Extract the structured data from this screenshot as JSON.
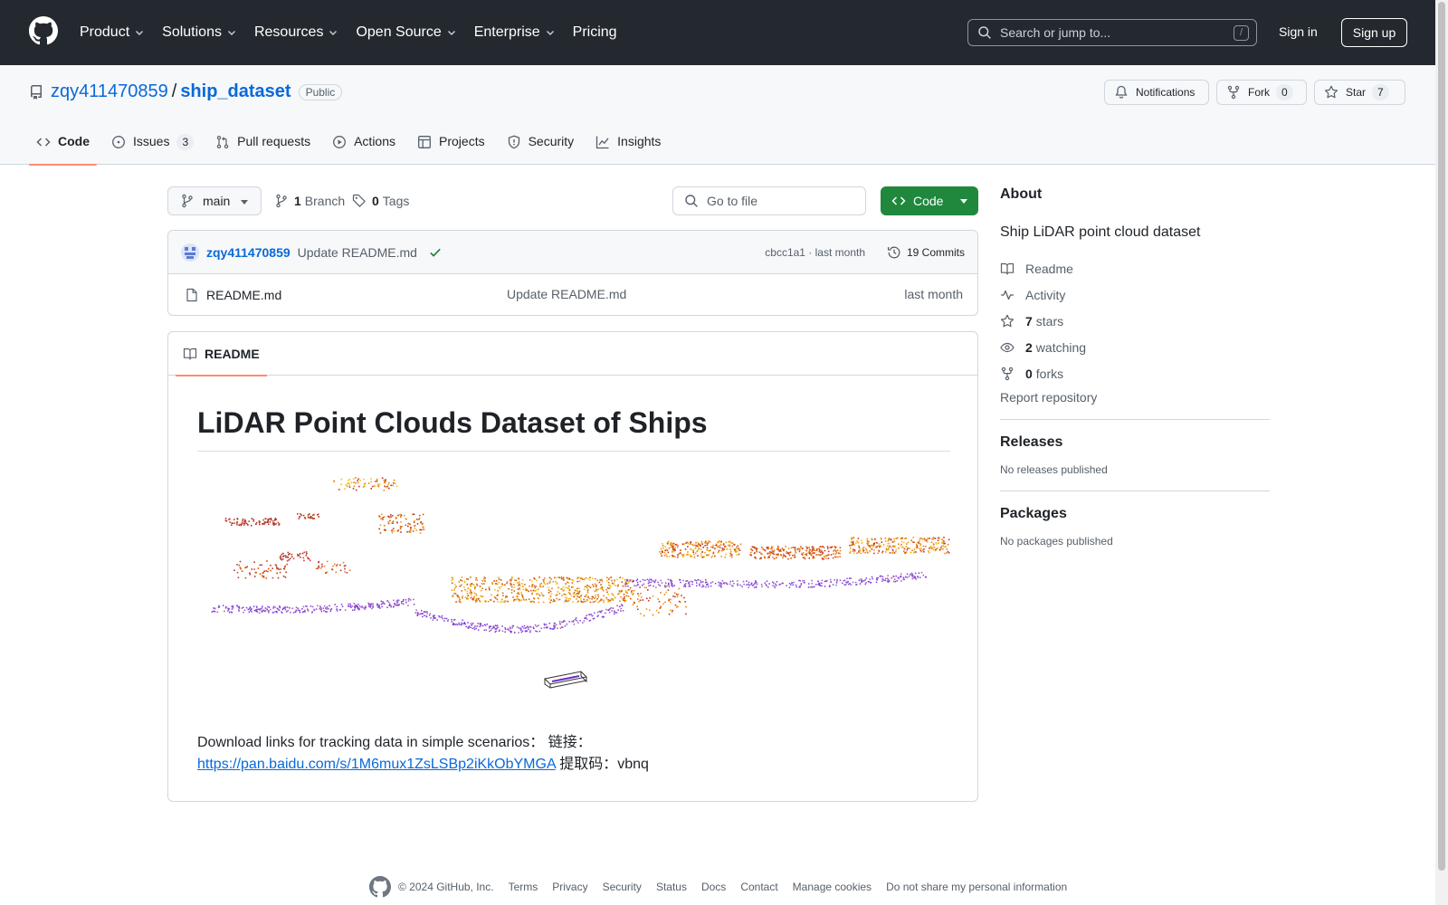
{
  "header": {
    "nav": [
      {
        "label": "Product"
      },
      {
        "label": "Solutions"
      },
      {
        "label": "Resources"
      },
      {
        "label": "Open Source"
      },
      {
        "label": "Enterprise"
      },
      {
        "label": "Pricing"
      }
    ],
    "search_placeholder": "Search or jump to...",
    "search_shortcut": "/",
    "sign_in": "Sign in",
    "sign_up": "Sign up"
  },
  "repo": {
    "owner": "zqy411470859",
    "separator": "/",
    "name": "ship_dataset",
    "visibility": "Public",
    "notifications_label": "Notifications",
    "fork_label": "Fork",
    "fork_count": "0",
    "star_label": "Star",
    "star_count": "7",
    "tabs": [
      {
        "label": "Code"
      },
      {
        "label": "Issues",
        "count": "3"
      },
      {
        "label": "Pull requests"
      },
      {
        "label": "Actions"
      },
      {
        "label": "Projects"
      },
      {
        "label": "Security"
      },
      {
        "label": "Insights"
      }
    ]
  },
  "toolbar": {
    "branch": "main",
    "branch_count": "1",
    "branch_label": "Branch",
    "tag_count": "0",
    "tag_label": "Tags",
    "go_to_file": "Go to file",
    "code_button": "Code"
  },
  "commit": {
    "user": "zqy411470859",
    "message": "Update README.md",
    "hash_time": "cbcc1a1 · last month",
    "commits_label": "19 Commits"
  },
  "files": [
    {
      "name": "README.md",
      "message": "Update README.md",
      "time": "last month"
    }
  ],
  "readme": {
    "tab_label": "README",
    "title": "LiDAR Point Clouds Dataset of Ships",
    "download_text": "Download links for tracking data in simple scenarios： 链接：",
    "link": "https://pan.baidu.com/s/1M6mux1ZsLSBp2iKkObYMGA",
    "code_text": " 提取码：vbnq"
  },
  "about": {
    "heading": "About",
    "description": "Ship LiDAR point cloud dataset",
    "readme": "Readme",
    "activity": "Activity",
    "stars_count": "7",
    "stars_label": "stars",
    "watching_count": "2",
    "watching_label": "watching",
    "forks_count": "0",
    "forks_label": "forks",
    "report": "Report repository"
  },
  "releases": {
    "heading": "Releases",
    "empty": "No releases published"
  },
  "packages": {
    "heading": "Packages",
    "empty": "No packages published"
  },
  "footer": {
    "copyright": "© 2024 GitHub, Inc.",
    "links": [
      "Terms",
      "Privacy",
      "Security",
      "Status",
      "Docs",
      "Contact",
      "Manage cookies",
      "Do not share my personal information"
    ]
  },
  "colors": {
    "header_bg": "#24292f",
    "link": "#0969da",
    "primary_button": "#1f883d",
    "tab_underline": "#fd8c73"
  }
}
